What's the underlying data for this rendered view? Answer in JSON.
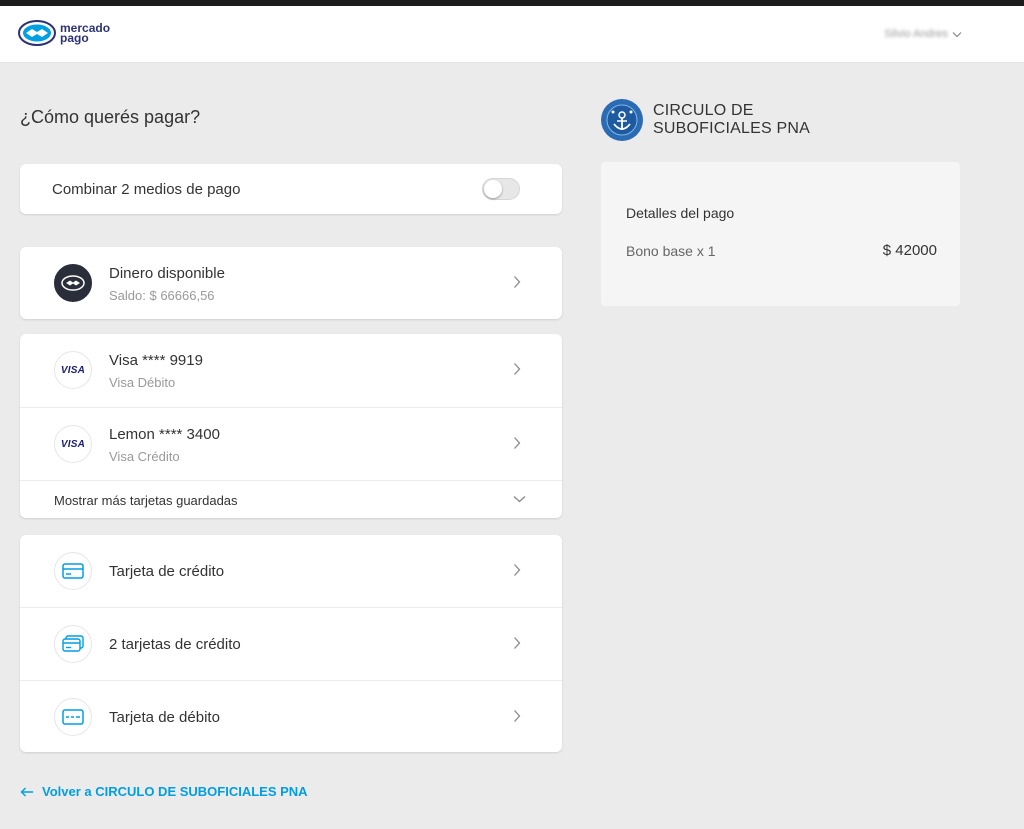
{
  "header": {
    "logo_line1": "mercado",
    "logo_line2": "pago",
    "user_name": "Silvio Andres"
  },
  "page_title": "¿Cómo querés pagar?",
  "combine": {
    "label": "Combinar 2 medios de pago",
    "enabled": false
  },
  "balance": {
    "title": "Dinero disponible",
    "subtitle": "Saldo: $  66666,56"
  },
  "saved_cards": [
    {
      "brand": "VISA",
      "title": "Visa **** 9919",
      "subtitle": "Visa Débito"
    },
    {
      "brand": "VISA",
      "title": "Lemon **** 3400",
      "subtitle": "Visa Crédito"
    }
  ],
  "show_more_label": "Mostrar más tarjetas guardadas",
  "new_methods": [
    {
      "label": "Tarjeta de crédito",
      "icon": "credit-card-icon"
    },
    {
      "label": "2 tarjetas de crédito",
      "icon": "two-cards-icon"
    },
    {
      "label": "Tarjeta de débito",
      "icon": "debit-card-icon"
    }
  ],
  "back_link": "Volver a CIRCULO DE SUBOFICIALES PNA",
  "merchant": {
    "name_line1": "CIRCULO DE",
    "name_line2": "SUBOFICIALES PNA"
  },
  "payment_details": {
    "heading": "Detalles del pago",
    "item": "Bono base x 1",
    "amount": "$ 42000"
  },
  "colors": {
    "accent": "#009ee3",
    "page_background": "#ebebeb",
    "card_background": "#ffffff",
    "brand_blue": "#2d3277"
  }
}
